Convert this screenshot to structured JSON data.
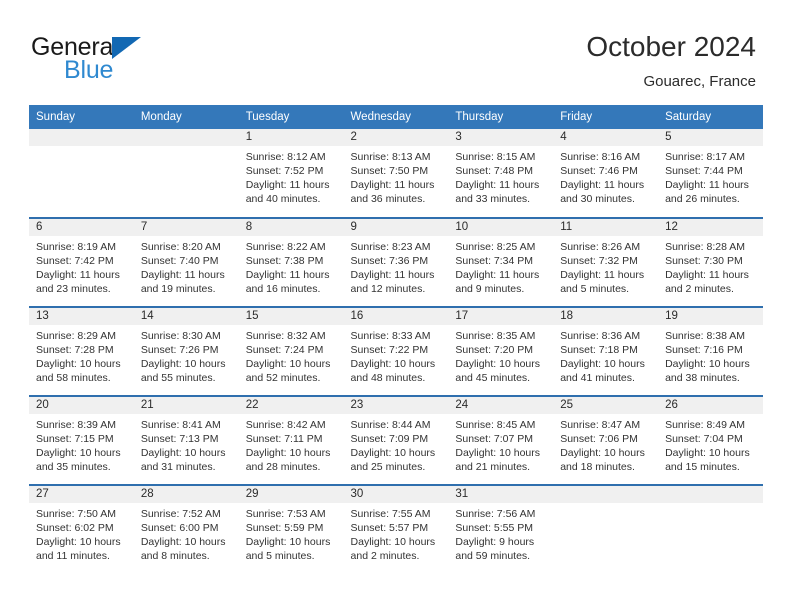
{
  "brand": {
    "name_part1": "General",
    "name_part2": "Blue",
    "triangle_color": "#1268b3",
    "blue_color": "#2f89d0"
  },
  "header": {
    "title": "October 2024",
    "subtitle": "Gouarec, France"
  },
  "theme": {
    "header_bar_color": "#3478ba",
    "row_divider_color": "#2f6fae",
    "day_band_color": "#f0f0f0",
    "page_background": "#ffffff"
  },
  "weekday_headers": [
    "Sunday",
    "Monday",
    "Tuesday",
    "Wednesday",
    "Thursday",
    "Friday",
    "Saturday"
  ],
  "labels": {
    "sunrise_prefix": "Sunrise:",
    "sunset_prefix": "Sunset:",
    "daylight_prefix": "Daylight:"
  },
  "weeks": [
    [
      {
        "day": "",
        "sunrise": "",
        "sunset": "",
        "daylight_line1": "",
        "daylight_line2": ""
      },
      {
        "day": "",
        "sunrise": "",
        "sunset": "",
        "daylight_line1": "",
        "daylight_line2": ""
      },
      {
        "day": "1",
        "sunrise": "Sunrise: 8:12 AM",
        "sunset": "Sunset: 7:52 PM",
        "daylight_line1": "Daylight: 11 hours",
        "daylight_line2": "and 40 minutes."
      },
      {
        "day": "2",
        "sunrise": "Sunrise: 8:13 AM",
        "sunset": "Sunset: 7:50 PM",
        "daylight_line1": "Daylight: 11 hours",
        "daylight_line2": "and 36 minutes."
      },
      {
        "day": "3",
        "sunrise": "Sunrise: 8:15 AM",
        "sunset": "Sunset: 7:48 PM",
        "daylight_line1": "Daylight: 11 hours",
        "daylight_line2": "and 33 minutes."
      },
      {
        "day": "4",
        "sunrise": "Sunrise: 8:16 AM",
        "sunset": "Sunset: 7:46 PM",
        "daylight_line1": "Daylight: 11 hours",
        "daylight_line2": "and 30 minutes."
      },
      {
        "day": "5",
        "sunrise": "Sunrise: 8:17 AM",
        "sunset": "Sunset: 7:44 PM",
        "daylight_line1": "Daylight: 11 hours",
        "daylight_line2": "and 26 minutes."
      }
    ],
    [
      {
        "day": "6",
        "sunrise": "Sunrise: 8:19 AM",
        "sunset": "Sunset: 7:42 PM",
        "daylight_line1": "Daylight: 11 hours",
        "daylight_line2": "and 23 minutes."
      },
      {
        "day": "7",
        "sunrise": "Sunrise: 8:20 AM",
        "sunset": "Sunset: 7:40 PM",
        "daylight_line1": "Daylight: 11 hours",
        "daylight_line2": "and 19 minutes."
      },
      {
        "day": "8",
        "sunrise": "Sunrise: 8:22 AM",
        "sunset": "Sunset: 7:38 PM",
        "daylight_line1": "Daylight: 11 hours",
        "daylight_line2": "and 16 minutes."
      },
      {
        "day": "9",
        "sunrise": "Sunrise: 8:23 AM",
        "sunset": "Sunset: 7:36 PM",
        "daylight_line1": "Daylight: 11 hours",
        "daylight_line2": "and 12 minutes."
      },
      {
        "day": "10",
        "sunrise": "Sunrise: 8:25 AM",
        "sunset": "Sunset: 7:34 PM",
        "daylight_line1": "Daylight: 11 hours",
        "daylight_line2": "and 9 minutes."
      },
      {
        "day": "11",
        "sunrise": "Sunrise: 8:26 AM",
        "sunset": "Sunset: 7:32 PM",
        "daylight_line1": "Daylight: 11 hours",
        "daylight_line2": "and 5 minutes."
      },
      {
        "day": "12",
        "sunrise": "Sunrise: 8:28 AM",
        "sunset": "Sunset: 7:30 PM",
        "daylight_line1": "Daylight: 11 hours",
        "daylight_line2": "and 2 minutes."
      }
    ],
    [
      {
        "day": "13",
        "sunrise": "Sunrise: 8:29 AM",
        "sunset": "Sunset: 7:28 PM",
        "daylight_line1": "Daylight: 10 hours",
        "daylight_line2": "and 58 minutes."
      },
      {
        "day": "14",
        "sunrise": "Sunrise: 8:30 AM",
        "sunset": "Sunset: 7:26 PM",
        "daylight_line1": "Daylight: 10 hours",
        "daylight_line2": "and 55 minutes."
      },
      {
        "day": "15",
        "sunrise": "Sunrise: 8:32 AM",
        "sunset": "Sunset: 7:24 PM",
        "daylight_line1": "Daylight: 10 hours",
        "daylight_line2": "and 52 minutes."
      },
      {
        "day": "16",
        "sunrise": "Sunrise: 8:33 AM",
        "sunset": "Sunset: 7:22 PM",
        "daylight_line1": "Daylight: 10 hours",
        "daylight_line2": "and 48 minutes."
      },
      {
        "day": "17",
        "sunrise": "Sunrise: 8:35 AM",
        "sunset": "Sunset: 7:20 PM",
        "daylight_line1": "Daylight: 10 hours",
        "daylight_line2": "and 45 minutes."
      },
      {
        "day": "18",
        "sunrise": "Sunrise: 8:36 AM",
        "sunset": "Sunset: 7:18 PM",
        "daylight_line1": "Daylight: 10 hours",
        "daylight_line2": "and 41 minutes."
      },
      {
        "day": "19",
        "sunrise": "Sunrise: 8:38 AM",
        "sunset": "Sunset: 7:16 PM",
        "daylight_line1": "Daylight: 10 hours",
        "daylight_line2": "and 38 minutes."
      }
    ],
    [
      {
        "day": "20",
        "sunrise": "Sunrise: 8:39 AM",
        "sunset": "Sunset: 7:15 PM",
        "daylight_line1": "Daylight: 10 hours",
        "daylight_line2": "and 35 minutes."
      },
      {
        "day": "21",
        "sunrise": "Sunrise: 8:41 AM",
        "sunset": "Sunset: 7:13 PM",
        "daylight_line1": "Daylight: 10 hours",
        "daylight_line2": "and 31 minutes."
      },
      {
        "day": "22",
        "sunrise": "Sunrise: 8:42 AM",
        "sunset": "Sunset: 7:11 PM",
        "daylight_line1": "Daylight: 10 hours",
        "daylight_line2": "and 28 minutes."
      },
      {
        "day": "23",
        "sunrise": "Sunrise: 8:44 AM",
        "sunset": "Sunset: 7:09 PM",
        "daylight_line1": "Daylight: 10 hours",
        "daylight_line2": "and 25 minutes."
      },
      {
        "day": "24",
        "sunrise": "Sunrise: 8:45 AM",
        "sunset": "Sunset: 7:07 PM",
        "daylight_line1": "Daylight: 10 hours",
        "daylight_line2": "and 21 minutes."
      },
      {
        "day": "25",
        "sunrise": "Sunrise: 8:47 AM",
        "sunset": "Sunset: 7:06 PM",
        "daylight_line1": "Daylight: 10 hours",
        "daylight_line2": "and 18 minutes."
      },
      {
        "day": "26",
        "sunrise": "Sunrise: 8:49 AM",
        "sunset": "Sunset: 7:04 PM",
        "daylight_line1": "Daylight: 10 hours",
        "daylight_line2": "and 15 minutes."
      }
    ],
    [
      {
        "day": "27",
        "sunrise": "Sunrise: 7:50 AM",
        "sunset": "Sunset: 6:02 PM",
        "daylight_line1": "Daylight: 10 hours",
        "daylight_line2": "and 11 minutes."
      },
      {
        "day": "28",
        "sunrise": "Sunrise: 7:52 AM",
        "sunset": "Sunset: 6:00 PM",
        "daylight_line1": "Daylight: 10 hours",
        "daylight_line2": "and 8 minutes."
      },
      {
        "day": "29",
        "sunrise": "Sunrise: 7:53 AM",
        "sunset": "Sunset: 5:59 PM",
        "daylight_line1": "Daylight: 10 hours",
        "daylight_line2": "and 5 minutes."
      },
      {
        "day": "30",
        "sunrise": "Sunrise: 7:55 AM",
        "sunset": "Sunset: 5:57 PM",
        "daylight_line1": "Daylight: 10 hours",
        "daylight_line2": "and 2 minutes."
      },
      {
        "day": "31",
        "sunrise": "Sunrise: 7:56 AM",
        "sunset": "Sunset: 5:55 PM",
        "daylight_line1": "Daylight: 9 hours",
        "daylight_line2": "and 59 minutes."
      },
      {
        "day": "",
        "sunrise": "",
        "sunset": "",
        "daylight_line1": "",
        "daylight_line2": ""
      },
      {
        "day": "",
        "sunrise": "",
        "sunset": "",
        "daylight_line1": "",
        "daylight_line2": ""
      }
    ]
  ]
}
